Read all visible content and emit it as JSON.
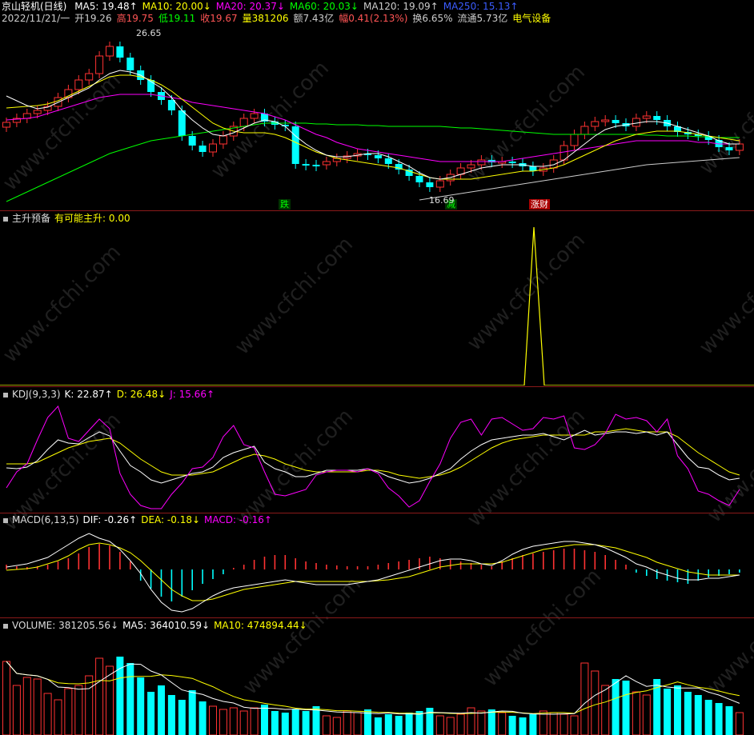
{
  "header": {
    "name": "京山轻机(日线)",
    "ma_items": [
      {
        "text": "MA5: 19.48↑",
        "color": "#ffffff"
      },
      {
        "text": "MA10: 20.00↓",
        "color": "#ffff00"
      },
      {
        "text": "MA20: 20.37↓",
        "color": "#ff00ff"
      },
      {
        "text": "MA60: 20.03↓",
        "color": "#00ff00"
      },
      {
        "text": "MA120: 19.09↑",
        "color": "#cccccc"
      },
      {
        "text": "MA250: 15.13↑",
        "color": "#3b5cff"
      }
    ],
    "quote_items": [
      {
        "text": "2022/11/21/一",
        "color": "#cccccc"
      },
      {
        "text": "开19.26",
        "color": "#cccccc"
      },
      {
        "text": "高19.75",
        "color": "#ff5555"
      },
      {
        "text": "低19.11",
        "color": "#00ff00"
      },
      {
        "text": "收19.67",
        "color": "#ff5555"
      },
      {
        "text": "量381206",
        "color": "#ffff00"
      },
      {
        "text": "额7.43亿",
        "color": "#cccccc"
      },
      {
        "text": "幅0.41(2.13%)",
        "color": "#ff5555"
      },
      {
        "text": "换6.65%",
        "color": "#cccccc"
      },
      {
        "text": "流通5.73亿",
        "color": "#cccccc"
      },
      {
        "text": "电气设备",
        "color": "#ffff00"
      }
    ]
  },
  "price_panel": {
    "high_label": "26.65",
    "low_label": "16.69",
    "tags": [
      {
        "text": "跌",
        "color": "#00ff00",
        "bg": "#004400"
      },
      {
        "text": "减",
        "color": "#00ff00",
        "bg": "#004400"
      },
      {
        "text": "涨财",
        "color": "#ffffff",
        "bg": "#aa0000"
      }
    ]
  },
  "indicator_panel": {
    "title": "主升预备",
    "items": [
      {
        "text": "有可能主升: 0.00",
        "color": "#ffff00"
      }
    ]
  },
  "kdj_panel": {
    "title": "KDJ(9,3,3)",
    "items": [
      {
        "text": "K: 22.87↑",
        "color": "#ffffff"
      },
      {
        "text": "D: 26.48↓",
        "color": "#ffff00"
      },
      {
        "text": "J: 15.66↑",
        "color": "#ff00ff"
      }
    ]
  },
  "macd_panel": {
    "title": "MACD(6,13,5)",
    "items": [
      {
        "text": "DIF: -0.26↑",
        "color": "#ffffff"
      },
      {
        "text": "DEA: -0.18↓",
        "color": "#ffff00"
      },
      {
        "text": "MACD: -0.16↑",
        "color": "#ff00ff"
      }
    ]
  },
  "volume_panel": {
    "title": "VOLUME: 381205.56↓",
    "items": [
      {
        "text": "MA5: 364010.59↓",
        "color": "#ffffff"
      },
      {
        "text": "MA10: 474894.44↓",
        "color": "#ffff00"
      }
    ]
  },
  "watermark": "www.cfchi.com",
  "colors": {
    "up": "#ff3232",
    "down": "#00ffff",
    "separator": "#8b1a1a",
    "ma5": "#ffffff",
    "ma10": "#ffff00",
    "ma20": "#ff00ff",
    "ma60": "#00ff00",
    "ma120": "#cccccc"
  }
}
